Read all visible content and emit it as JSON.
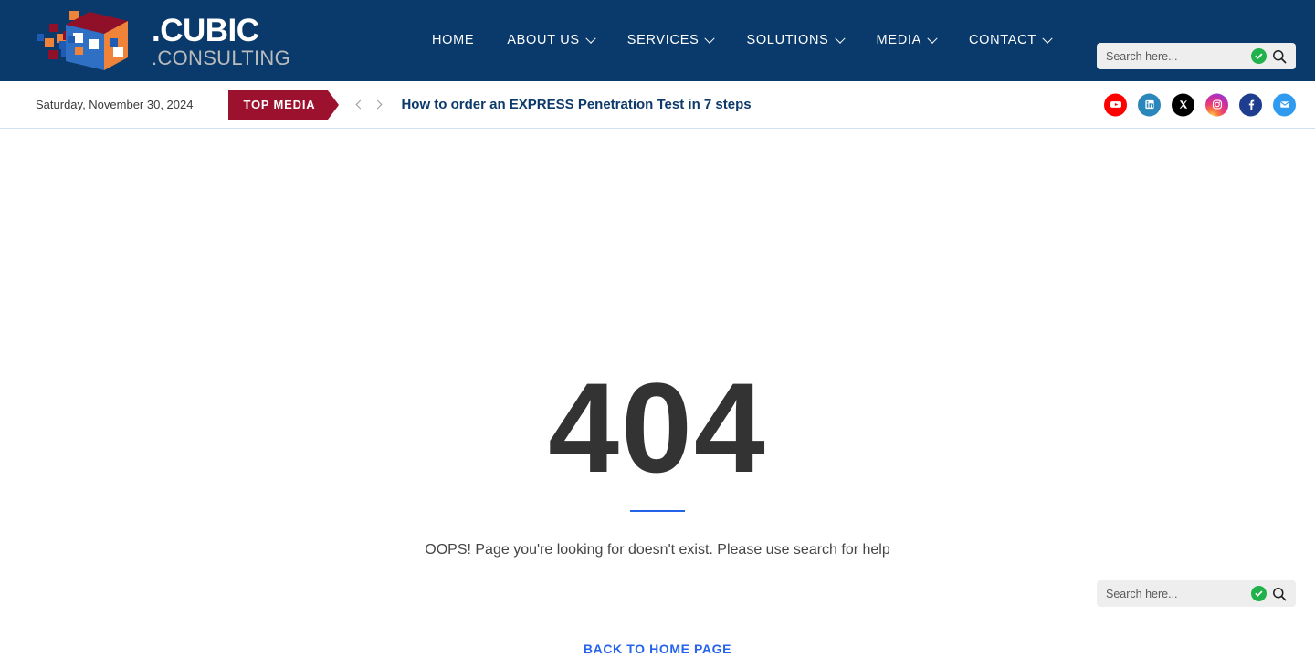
{
  "header": {
    "logo": {
      "name_line1": ".CUBIC",
      "name_line2": ".CONSULTING",
      "alt": "Cubic Consulting logo"
    },
    "nav": [
      {
        "label": "HOME",
        "has_dropdown": false
      },
      {
        "label": "ABOUT US",
        "has_dropdown": true
      },
      {
        "label": "SERVICES",
        "has_dropdown": true
      },
      {
        "label": "SOLUTIONS",
        "has_dropdown": true
      },
      {
        "label": "MEDIA",
        "has_dropdown": true
      },
      {
        "label": "CONTACT",
        "has_dropdown": true
      }
    ],
    "search": {
      "placeholder": "Search here...",
      "value": ""
    },
    "background_color": "#0a3a6b"
  },
  "ticker": {
    "date": "Saturday, November 30, 2024",
    "badge_label": "TOP MEDIA",
    "badge_color": "#9c122e",
    "headline": "How to order an EXPRESS Penetration Test in 7 steps",
    "prev_label": "Previous",
    "next_label": "Next",
    "social": [
      {
        "name": "youtube",
        "label": "YouTube"
      },
      {
        "name": "linkedin",
        "label": "LinkedIn"
      },
      {
        "name": "x",
        "label": "X"
      },
      {
        "name": "instagram",
        "label": "Instagram"
      },
      {
        "name": "facebook",
        "label": "Facebook"
      },
      {
        "name": "email",
        "label": "Email"
      }
    ]
  },
  "main": {
    "error_code": "404",
    "message": "OOPS! Page you're looking for doesn't exist. Please use search for help",
    "back_link_label": "BACK TO HOME PAGE",
    "search": {
      "placeholder": "Search here...",
      "value": ""
    },
    "accent_color": "#2563eb",
    "code_color": "#333333"
  }
}
